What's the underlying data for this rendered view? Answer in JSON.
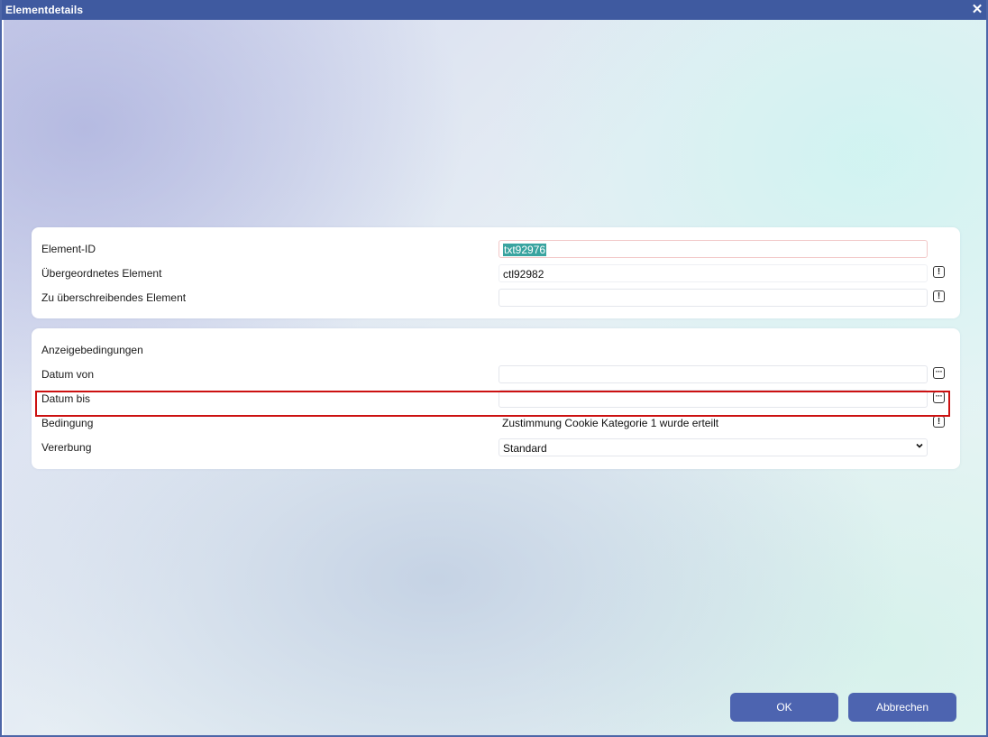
{
  "window": {
    "title": "Elementdetails",
    "close_symbol": "✕"
  },
  "general": {
    "element_id": {
      "label": "Element-ID",
      "value": "txt92976"
    },
    "parent": {
      "label": "Übergeordnetes Element",
      "value": "ctl92982",
      "button_icon": "info-icon"
    },
    "override": {
      "label": "Zu überschreibendes Element",
      "value": "",
      "button_icon": "info-icon"
    }
  },
  "display_conditions": {
    "title": "Anzeigebedingungen",
    "date_from": {
      "label": "Datum von",
      "value": "",
      "button_icon": "ellipsis-icon"
    },
    "date_to": {
      "label": "Datum bis",
      "value": "",
      "button_icon": "ellipsis-icon"
    },
    "condition": {
      "label": "Bedingung",
      "value": "Zustimmung Cookie  Kategorie 1 wurde erteilt",
      "button_icon": "info-icon"
    },
    "inheritance": {
      "label": "Vererbung",
      "selected": "Standard"
    }
  },
  "buttons": {
    "ok": "OK",
    "cancel": "Abbrechen"
  },
  "colors": {
    "titlebar": "#3f5aa0",
    "button": "#4d64b0",
    "highlight_border": "#cc1111",
    "selection": "#3aa4a0"
  }
}
